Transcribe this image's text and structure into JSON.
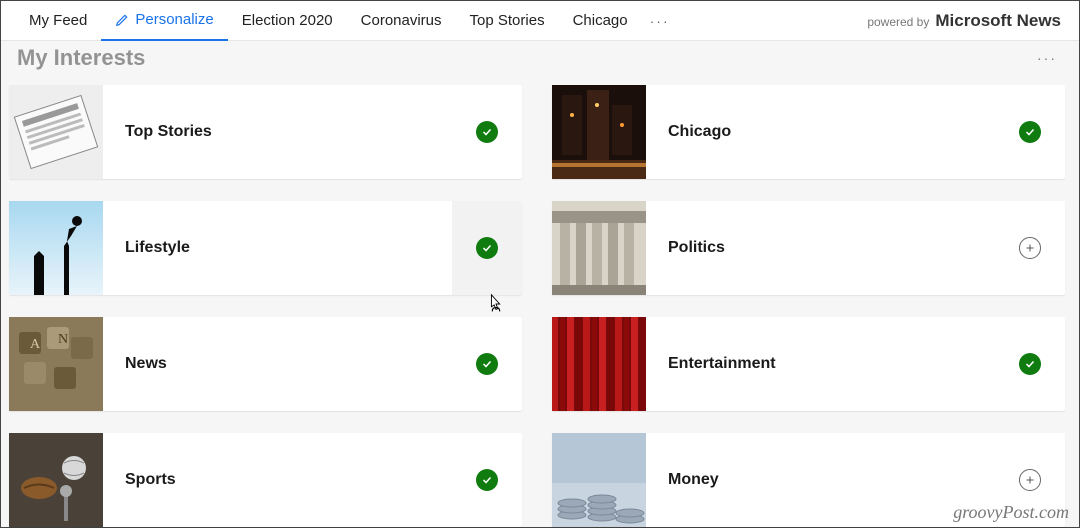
{
  "nav": {
    "items": [
      {
        "label": "My Feed",
        "active": false,
        "name": "nav-my-feed"
      },
      {
        "label": "Personalize",
        "active": true,
        "name": "nav-personalize"
      },
      {
        "label": "Election 2020",
        "active": false,
        "name": "nav-election-2020"
      },
      {
        "label": "Coronavirus",
        "active": false,
        "name": "nav-coronavirus"
      },
      {
        "label": "Top Stories",
        "active": false,
        "name": "nav-top-stories"
      },
      {
        "label": "Chicago",
        "active": false,
        "name": "nav-chicago"
      }
    ],
    "more_glyph": "···",
    "powered_label": "powered by",
    "powered_brand": "Microsoft News"
  },
  "section": {
    "title": "My Interests",
    "more_glyph": "···"
  },
  "interests": [
    {
      "label": "Top Stories",
      "selected": true,
      "hover": false,
      "thumb": "newspaper",
      "name": "interest-top-stories"
    },
    {
      "label": "Chicago",
      "selected": true,
      "hover": false,
      "thumb": "city-night",
      "name": "interest-chicago"
    },
    {
      "label": "Lifestyle",
      "selected": true,
      "hover": true,
      "thumb": "silhouette",
      "name": "interest-lifestyle"
    },
    {
      "label": "Politics",
      "selected": false,
      "hover": false,
      "thumb": "columns",
      "name": "interest-politics"
    },
    {
      "label": "News",
      "selected": true,
      "hover": false,
      "thumb": "letters",
      "name": "interest-news"
    },
    {
      "label": "Entertainment",
      "selected": true,
      "hover": false,
      "thumb": "curtain",
      "name": "interest-entertainment"
    },
    {
      "label": "Sports",
      "selected": true,
      "hover": false,
      "thumb": "sports",
      "name": "interest-sports"
    },
    {
      "label": "Money",
      "selected": false,
      "hover": false,
      "thumb": "coins",
      "name": "interest-money"
    }
  ],
  "colors": {
    "accent": "#1a73e8",
    "check": "#107C10"
  },
  "watermark": "groovyPost.com"
}
